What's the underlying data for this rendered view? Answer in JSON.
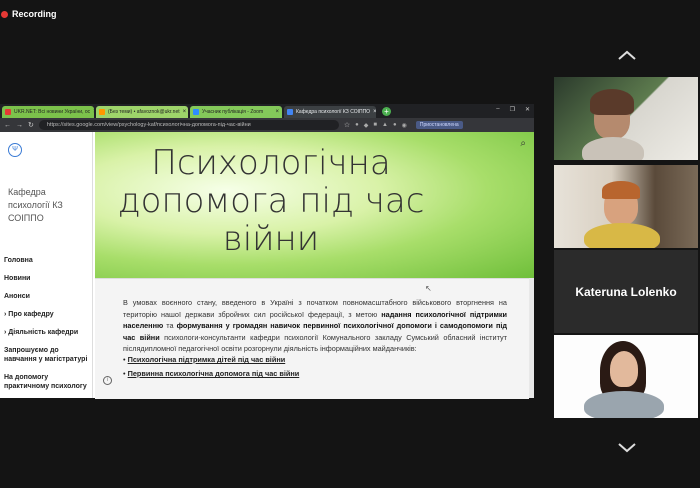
{
  "recording": {
    "label": "Recording"
  },
  "browser": {
    "tabs": [
      {
        "label": "UKR.NET: Всі новини України, ос",
        "fav_color": "#e53935"
      },
      {
        "label": "(Без теми) • afavoznok@ukr.net",
        "fav_color": "#ff9800"
      },
      {
        "label": "Учасник публікація - Zoom",
        "fav_color": "#2d8cff"
      },
      {
        "label": "Кафедра психології КЗ СОІППО",
        "fav_color": "#4285f4"
      }
    ],
    "url": "https://sites.google.com/view/psychology-kaf/психологічна-допомога-під-час-війни",
    "profile": "Приостановлена"
  },
  "site": {
    "title": "Кафедра психології КЗ СОІППО",
    "nav": [
      "Головна",
      "Новини",
      "Анонси",
      "Про кафедру",
      "Діяльність кафедри",
      "Запрошуємо до навчання у магістратурі",
      "На допомогу практичному психологу"
    ],
    "banner_title": "Психологічна допомога під час війни",
    "paragraph_start": "В умовах воєнного стану, введеного в Україні з початком повномасштабного військового вторгнення на територію нашої держави збройних сил російської федерації, з метою ",
    "paragraph_bold1": "надання психологічної підтримки населенню",
    "paragraph_mid1": " та ",
    "paragraph_bold2": "формування у громадян навичок первинної психологічної допомоги і самодопомоги під час війни",
    "paragraph_end": " психологи-консультанти кафедри психології Комунального закладу Сумський обласний інститут післядипломної педагогічної освіти розгорнули діяльність інформаційних майданчиків:",
    "links": [
      "Психологічна підтримка дітей під час війни",
      "Первинна психологічна допомога під час війни"
    ]
  },
  "participants": {
    "tile3_name": "Kateruna Lolenko"
  }
}
